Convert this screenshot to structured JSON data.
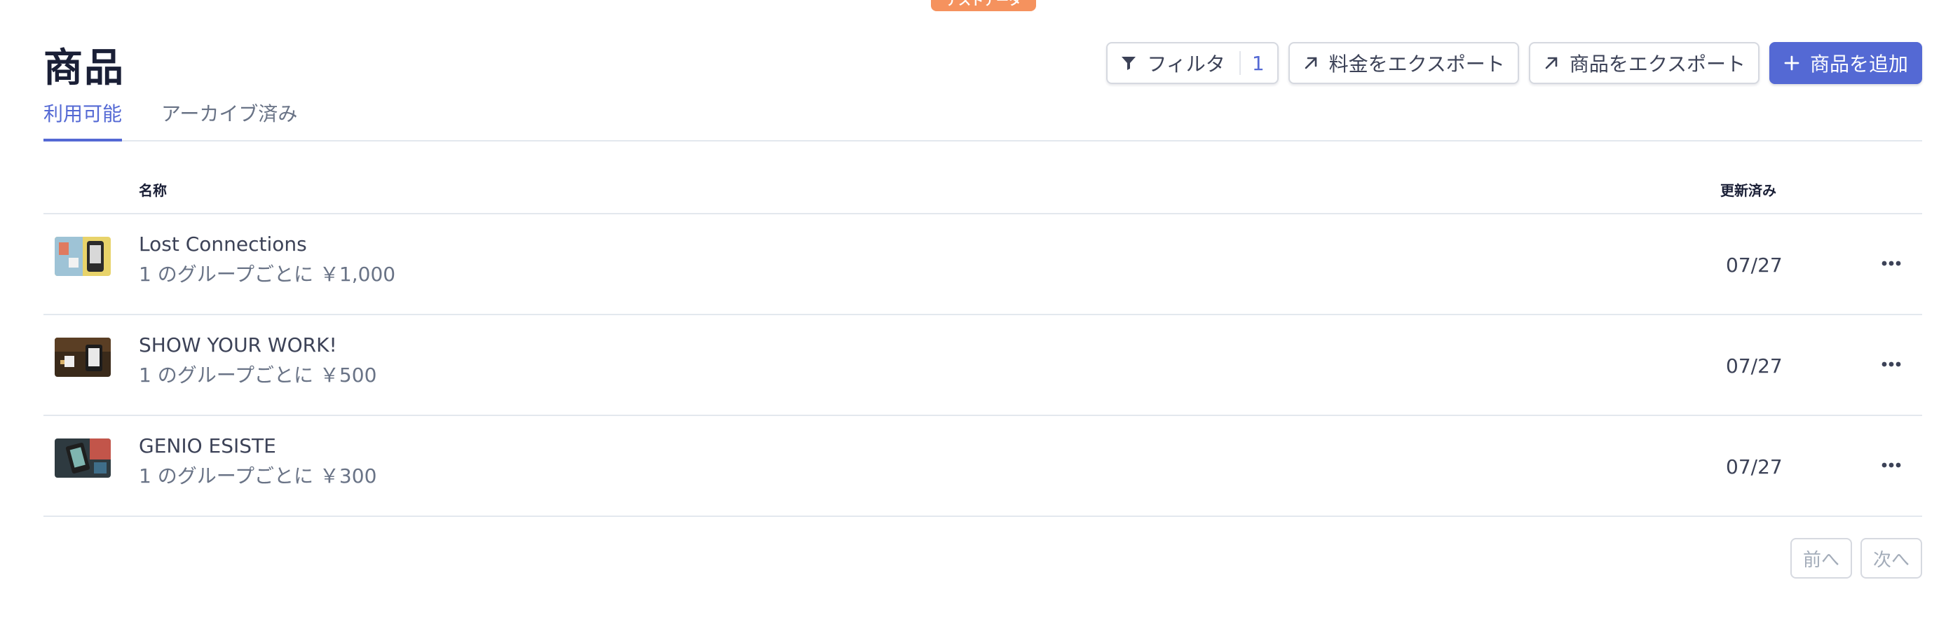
{
  "badge": {
    "label": "テストデータ"
  },
  "page": {
    "title": "商品"
  },
  "toolbar": {
    "filter_label": "フィルタ",
    "filter_count": "1",
    "export_prices_label": "料金をエクスポート",
    "export_products_label": "商品をエクスポート",
    "add_product_label": "商品を追加"
  },
  "tabs": [
    {
      "label": "利用可能",
      "active": true
    },
    {
      "label": "アーカイブ済み",
      "active": false
    }
  ],
  "table": {
    "columns": {
      "name": "名称",
      "updated": "更新済み"
    },
    "rows": [
      {
        "name": "Lost Connections",
        "price": "1 のグループごとに ￥1,000",
        "updated": "07/27"
      },
      {
        "name": "SHOW YOUR WORK!",
        "price": "1 のグループごとに ￥500",
        "updated": "07/27"
      },
      {
        "name": "GENIO ESISTE",
        "price": "1 のグループごとに ￥300",
        "updated": "07/27"
      }
    ]
  },
  "pagination": {
    "prev_label": "前へ",
    "next_label": "次へ"
  },
  "colors": {
    "accent": "#5469d4",
    "badge": "#f5925e",
    "border": "#e3e8ee"
  }
}
